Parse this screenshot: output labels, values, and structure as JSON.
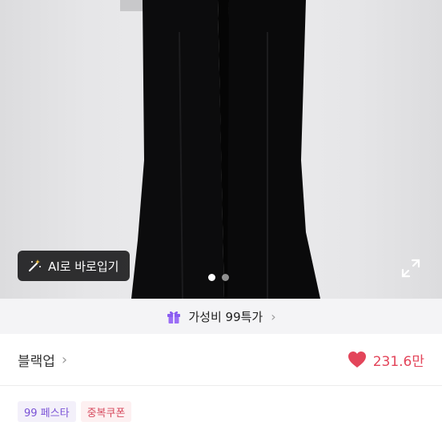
{
  "photo": {
    "ai_button_label": "AI로 바로입기",
    "icons": [
      "magic-wand-icon",
      "expand-icon"
    ],
    "carousel": {
      "total": 2,
      "active": 1
    }
  },
  "promo": {
    "label": "가성비 99특가",
    "icon": "gift-icon",
    "chevron": "›"
  },
  "store": {
    "name": "블랙업",
    "chevron": "›"
  },
  "likes": {
    "count": "231.6만",
    "icon": "heart-icon"
  },
  "badges": [
    {
      "label": "99 페스타"
    },
    {
      "label": "중복쿠폰"
    }
  ],
  "colors": {
    "accent_purple": "#7a52d6",
    "like_red": "#e3455a",
    "promo_bg": "#f4f4f6"
  }
}
